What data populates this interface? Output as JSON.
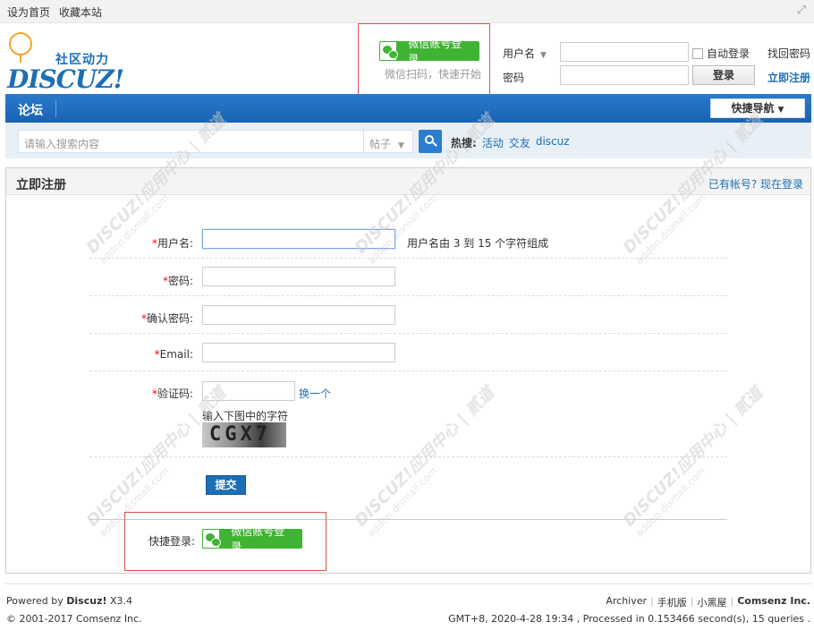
{
  "topbar": {
    "set_home": "设为首页",
    "bookmark": "收藏本站"
  },
  "logo": {
    "cn": "社区动力",
    "en": "DISCUZ!"
  },
  "wechat_top": {
    "button_label": "微信账号登录",
    "tip": "微信扫码，快速开始"
  },
  "login": {
    "username_label": "用户名",
    "password_label": "密码",
    "auto_login": "自动登录",
    "login_button": "登录",
    "find_password": "找回密码",
    "register": "立即注册"
  },
  "nav": {
    "forum": "论坛",
    "quick_nav": "快捷导航"
  },
  "search": {
    "placeholder": "请输入搜索内容",
    "type": "帖子",
    "hot_label": "热搜:",
    "hot_items": [
      "活动",
      "交友",
      "discuz"
    ]
  },
  "register": {
    "title": "立即注册",
    "have_account": "已有帐号? 现在登录",
    "username_label": "用户名:",
    "username_tip": "用户名由 3 到 15 个字符组成",
    "password_label": "密码:",
    "confirm_password_label": "确认密码:",
    "email_label": "Email:",
    "captcha_label": "验证码:",
    "change_captcha": "换一个",
    "captcha_hint": "输入下图中的字符",
    "captcha_text": "CGX7",
    "submit": "提交",
    "quick_login_label": "快捷登录:",
    "wechat_button": "微信账号登录"
  },
  "watermark": {
    "main": "DISCUZ!应用中心 | 贰道",
    "sub": "addon.dismall.com"
  },
  "footer": {
    "powered_prefix": "Powered by ",
    "powered_brand": "Discuz!",
    "powered_version": " X3.4",
    "copyright": "© 2001-2017 Comsenz Inc.",
    "links": [
      "Archiver",
      "手机版",
      "小黑屋"
    ],
    "company": "Comsenz Inc.",
    "gmt": "GMT+8, 2020-4-28 19:34 , Processed in 0.153466 second(s), 15 queries ."
  }
}
